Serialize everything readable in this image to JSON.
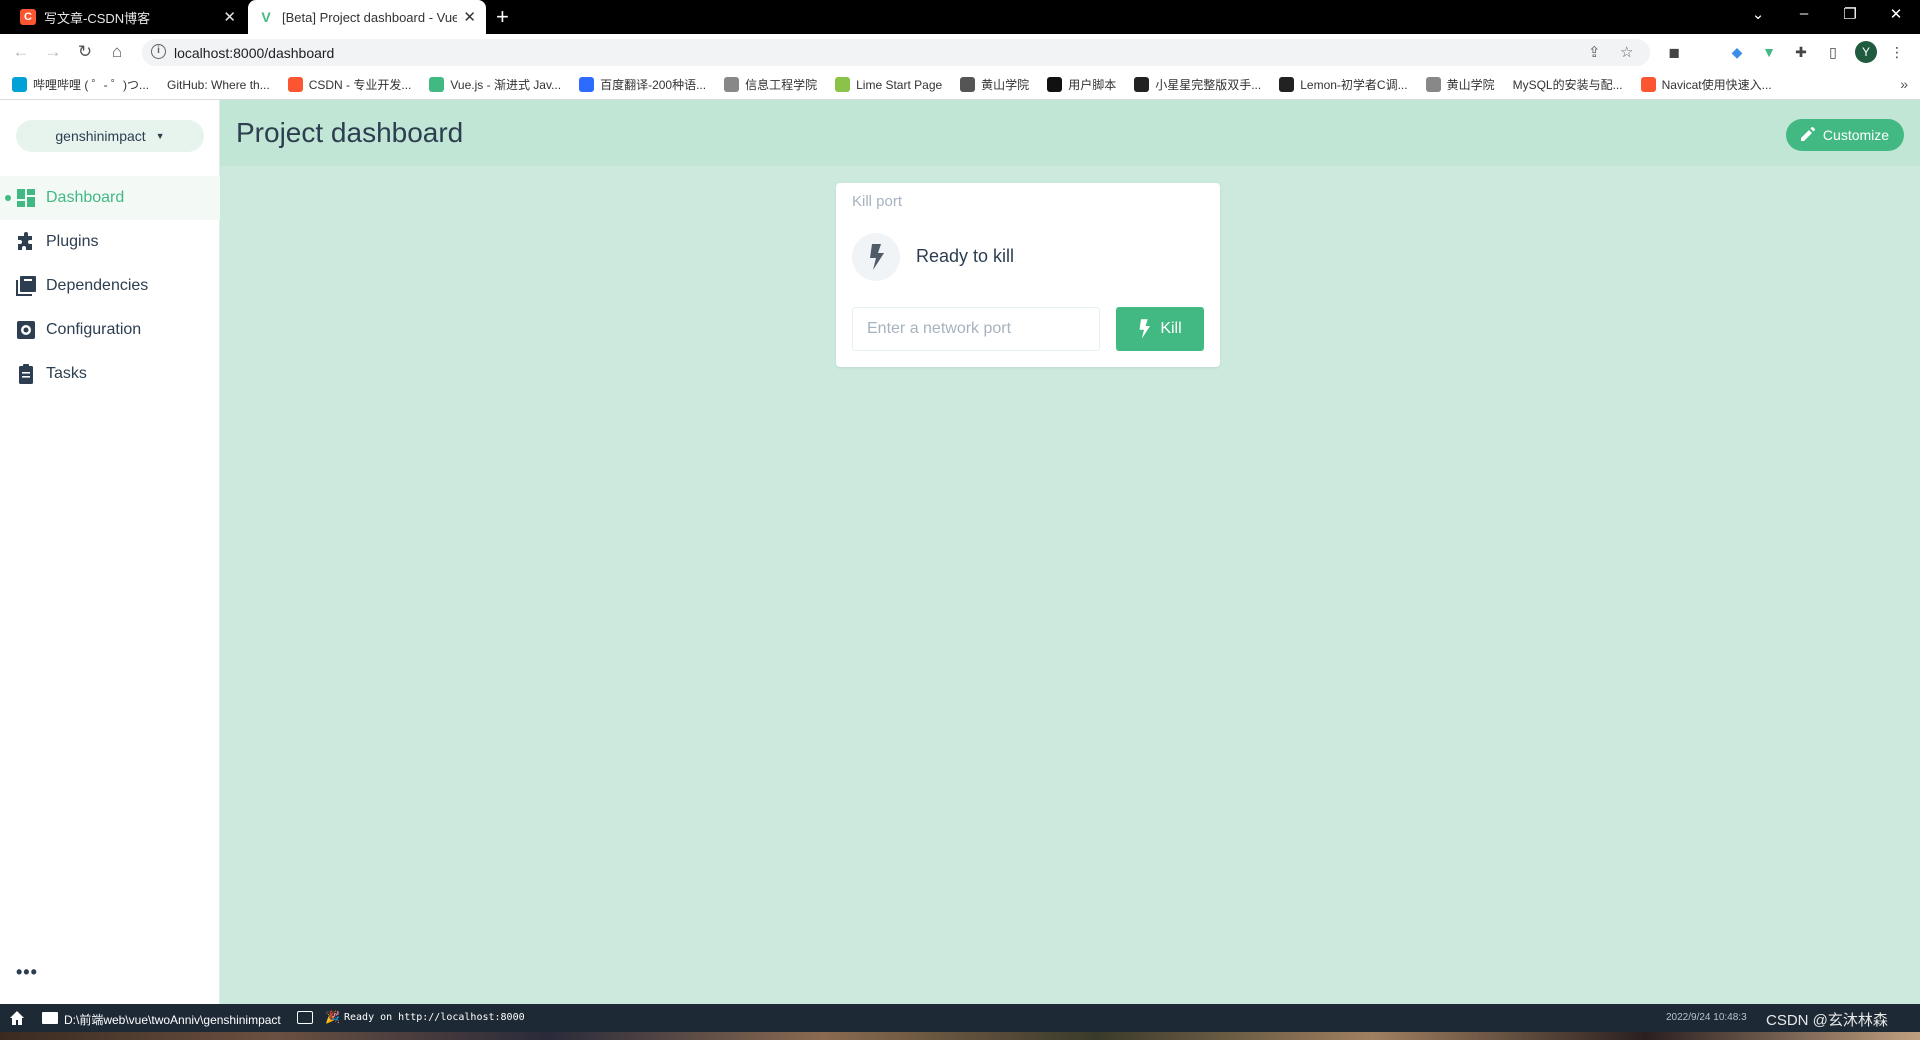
{
  "browser": {
    "tabs": [
      {
        "title": "写文章-CSDN博客",
        "favicon": "C",
        "active": false
      },
      {
        "title": "[Beta] Project dashboard - Vue",
        "favicon": "V",
        "active": true
      }
    ],
    "url": "localhost:8000/dashboard",
    "profile_initial": "Y",
    "bookmarks": [
      {
        "label": "哔哩哔哩 ( ゜- ゜)つ...",
        "icon": "bilibili-icon",
        "color": "#00a1d6"
      },
      {
        "label": "GitHub: Where th...",
        "icon": "none",
        "color": "#ffffff"
      },
      {
        "label": "CSDN - 专业开发...",
        "icon": "csdn-icon",
        "color": "#fc5531"
      },
      {
        "label": "Vue.js - 渐进式 Jav...",
        "icon": "vue-icon",
        "color": "#42b883"
      },
      {
        "label": "百度翻译-200种语...",
        "icon": "baidu-translate-icon",
        "color": "#2d6bff"
      },
      {
        "label": "信息工程学院",
        "icon": "globe-icon",
        "color": "#888888"
      },
      {
        "label": "Lime Start Page",
        "icon": "lime-icon",
        "color": "#8bc34a"
      },
      {
        "label": "黄山学院",
        "icon": "school-icon",
        "color": "#555555"
      },
      {
        "label": "用户脚本",
        "icon": "script-icon",
        "color": "#111111"
      },
      {
        "label": "小星星完整版双手...",
        "icon": "piano-icon",
        "color": "#222222"
      },
      {
        "label": "Lemon-初学者C调...",
        "icon": "piano-icon",
        "color": "#222222"
      },
      {
        "label": "黄山学院",
        "icon": "globe-icon",
        "color": "#888888"
      },
      {
        "label": "MySQL的安装与配...",
        "icon": "none",
        "color": "#ffffff"
      },
      {
        "label": "Navicat使用快速入...",
        "icon": "csdn-icon",
        "color": "#fc5531"
      }
    ]
  },
  "sidebar": {
    "project": "genshinimpact",
    "items": [
      {
        "label": "Dashboard",
        "icon": "dashboard-icon",
        "active": true
      },
      {
        "label": "Plugins",
        "icon": "puzzle-icon",
        "active": false
      },
      {
        "label": "Dependencies",
        "icon": "library-icon",
        "active": false
      },
      {
        "label": "Configuration",
        "icon": "settings-icon",
        "active": false
      },
      {
        "label": "Tasks",
        "icon": "clipboard-icon",
        "active": false
      }
    ],
    "more": "•••"
  },
  "header": {
    "title": "Project dashboard",
    "customize_label": "Customize"
  },
  "widget": {
    "title": "Kill port",
    "status": "Ready to kill",
    "input_placeholder": "Enter a network port",
    "input_value": "",
    "kill_label": "Kill"
  },
  "statusbar": {
    "path": "D:\\前端web\\vue\\twoAnniv\\genshinimpact",
    "message": "Ready on http://localhost:8000",
    "time": "2022/9/24 10:48:3",
    "watermark": "CSDN @玄沐林森"
  },
  "colors": {
    "accent": "#42b983",
    "header_bg": "#c2e6d6",
    "content_bg": "#cbe9dc",
    "text": "#2c3e50",
    "statusbar_bg": "#1d2935"
  }
}
